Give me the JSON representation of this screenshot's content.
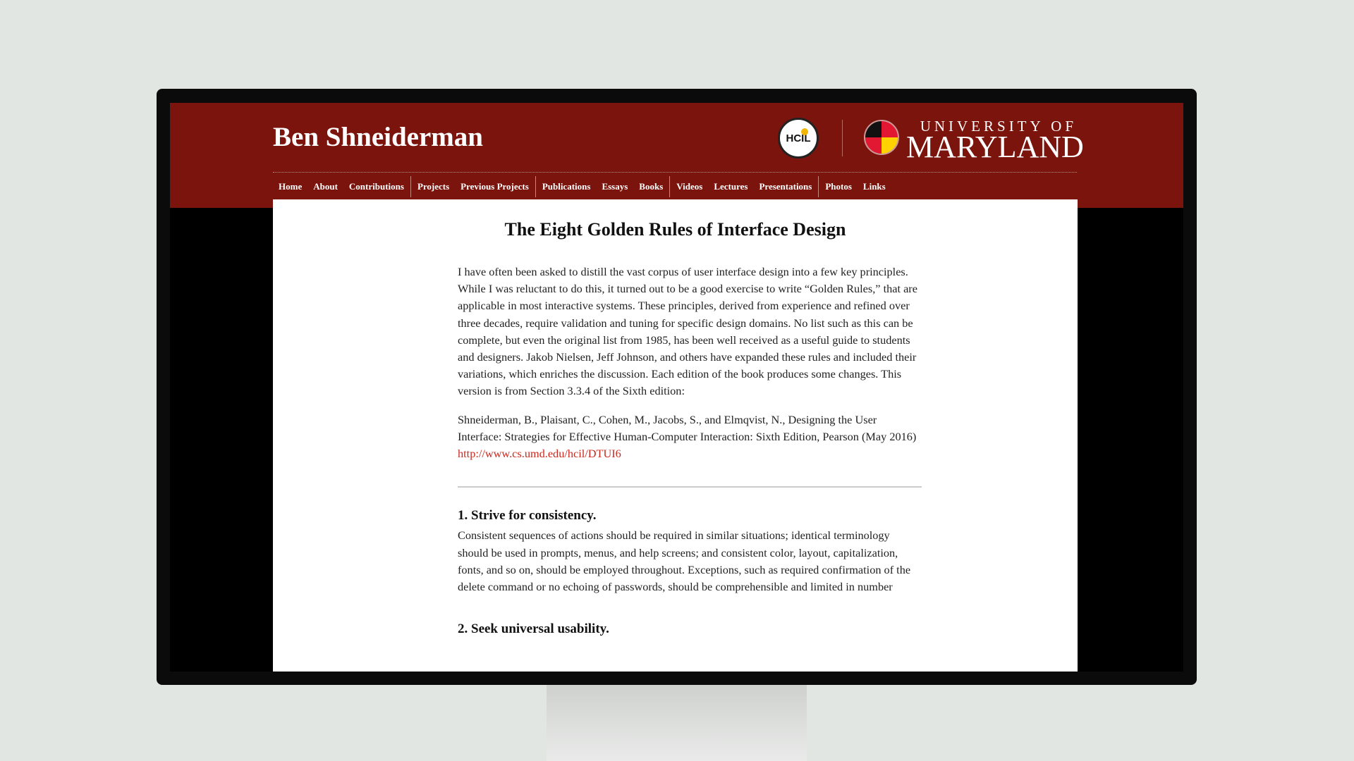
{
  "header": {
    "site_title": "Ben Shneiderman",
    "hcil_logo": "HCIL",
    "umd_logo": {
      "line1": "UNIVERSITY OF",
      "line2": "MARYLAND"
    },
    "brand_color": "#7a140c"
  },
  "nav": {
    "groups": [
      [
        "Home",
        "About",
        "Contributions"
      ],
      [
        "Projects",
        "Previous Projects"
      ],
      [
        "Publications",
        "Essays",
        "Books"
      ],
      [
        "Videos",
        "Lectures",
        "Presentations"
      ],
      [
        "Photos",
        "Links"
      ]
    ]
  },
  "article": {
    "title": "The Eight Golden Rules of Interface Design",
    "intro": "I have often been asked to distill the vast corpus of user interface design into a few key principles. While I was reluctant to do this, it turned out to be a good exercise to write “Golden Rules,” that are applicable in most interactive systems. These principles, derived from experience and refined over three decades, require validation and tuning for specific design domains. No list such as this can be complete, but even the original list from 1985, has been well received as a useful guide to students and designers. Jakob Nielsen, Jeff Johnson, and others have expanded these rules and included their variations, which enriches the discussion. Each edition of the book produces some changes. This version is from Section 3.3.4 of the Sixth edition:",
    "citation": "Shneiderman, B., Plaisant, C., Cohen, M., Jacobs, S., and Elmqvist, N., Designing the User Interface: Strategies for Effective Human-Computer Interaction: Sixth Edition, Pearson (May 2016)",
    "citation_link": "http://www.cs.umd.edu/hcil/DTUI6",
    "link_color": "#c8281e",
    "rules": [
      {
        "heading": "1. Strive for consistency.",
        "text": "Consistent sequences of actions should be required in similar situations; identical terminology should be used in prompts, menus, and help screens; and consistent color, layout, capitalization, fonts, and so on, should be employed throughout. Exceptions, such as required confirmation of the delete command or no echoing of passwords, should be comprehensible and limited in number"
      },
      {
        "heading": "2. Seek universal usability."
      }
    ]
  }
}
